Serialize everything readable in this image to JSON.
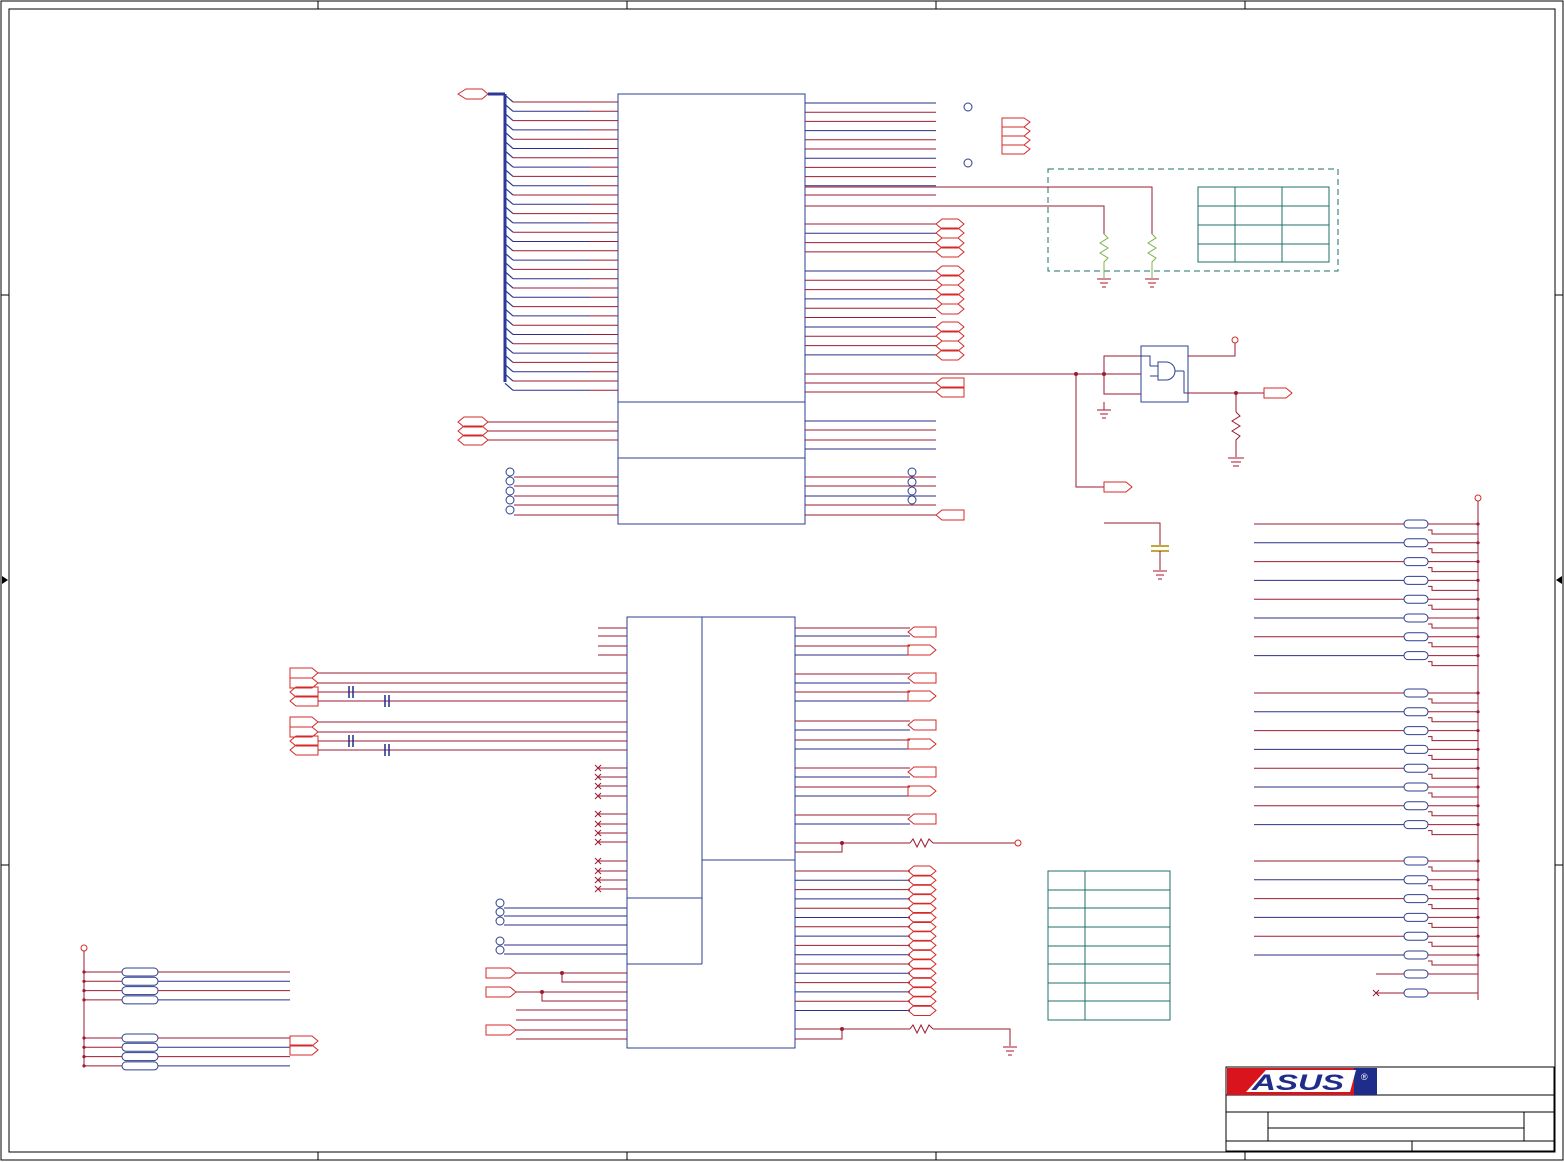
{
  "colors": {
    "border": "#000000",
    "wire": "#9b1b30",
    "wire_alt": "#2e2e8a",
    "bus": "#2b3a9a",
    "port": "#d42a2a",
    "component": "#2e3f8f",
    "table": "#1f6f6a",
    "ground": "#b0122a",
    "resistor_green": "#7fb04a",
    "logo_red": "#d9141c",
    "logo_blue": "#1f2d8a"
  },
  "icons": {
    "logo": "asus-logo",
    "ground": "ground-icon",
    "resistor": "resistor-icon",
    "capacitor": "capacitor-icon",
    "and_gate": "and-gate-icon",
    "off_page_connector": "off-page-connector-icon",
    "test_point": "test-point-icon"
  },
  "logo": {
    "brand": "ASUS",
    "registered_mark": "®"
  }
}
